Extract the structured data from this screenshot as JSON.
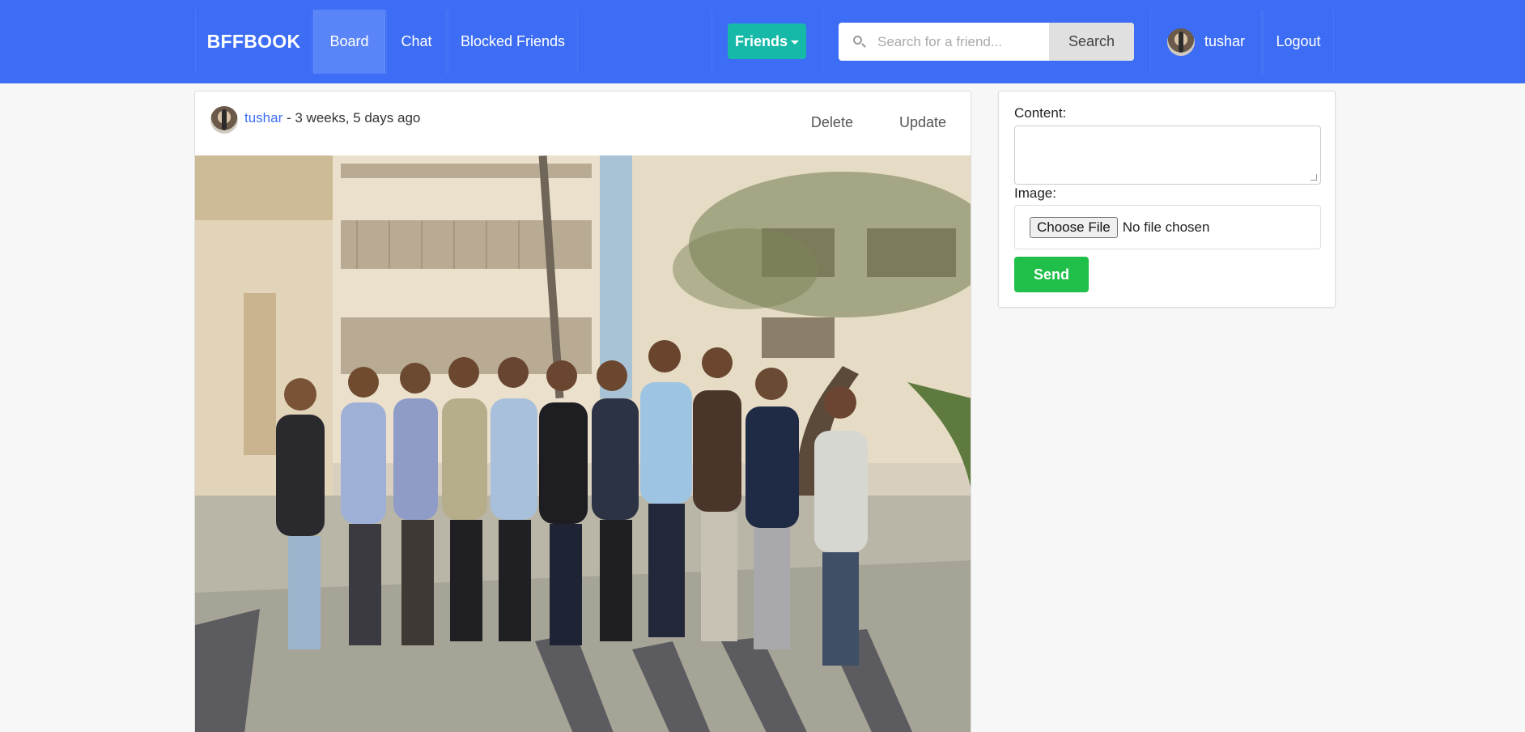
{
  "navbar": {
    "brand": "BFFBOOK",
    "links": [
      {
        "label": "Board",
        "active": true
      },
      {
        "label": "Chat"
      },
      {
        "label": "Blocked Friends"
      }
    ],
    "friends_dropdown": "Friends",
    "search": {
      "placeholder": "Search for a friend...",
      "button": "Search"
    },
    "user": {
      "name": "tushar"
    },
    "logout": "Logout"
  },
  "post": {
    "author": "tushar",
    "timestamp": "- 3 weeks, 5 days ago",
    "actions": {
      "delete": "Delete",
      "update": "Update"
    }
  },
  "form": {
    "content_label": "Content:",
    "image_label": "Image:",
    "choose_file": "Choose File",
    "file_status": "No file chosen",
    "send": "Send"
  },
  "colors": {
    "navbar": "#3d6df5",
    "active_nav": "#5a85f8",
    "friends_button": "#16b9a8",
    "send_button": "#1fbf4a",
    "link": "#3d6df5"
  },
  "icons": [
    "search-icon",
    "caret-down-icon",
    "avatar-icon"
  ]
}
